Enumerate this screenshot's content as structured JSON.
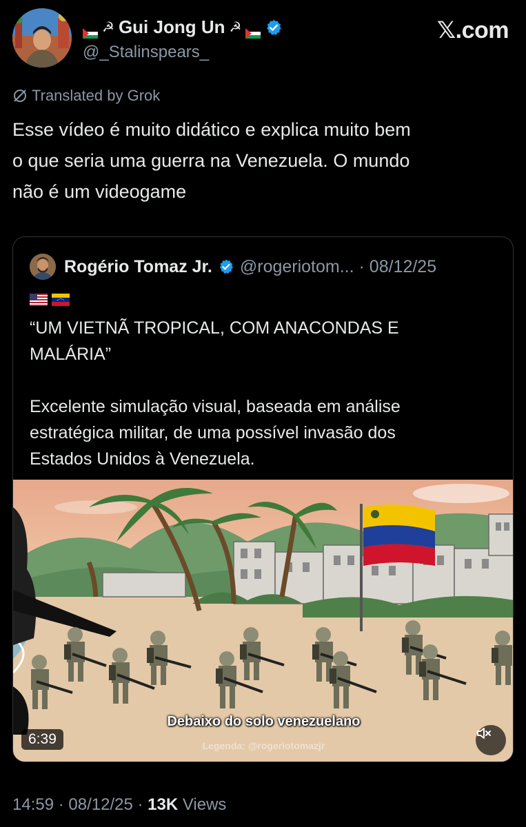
{
  "header": {
    "display_name": "Gui Jong Un",
    "handle": "@_Stalinspears_",
    "site": "𝕏.com"
  },
  "translated_label": "Translated by Grok",
  "tweet": {
    "text_lines": [
      "Esse vídeo é muito didático e explica muito bem",
      "o que seria uma guerra na Venezuela. O mundo",
      "não é um videogame"
    ]
  },
  "quote": {
    "name": "Rogério Tomaz Jr.",
    "handle_date": "@rogeriotom... · 08/12/25",
    "headline_lines": [
      "“UM VIETNÃ TROPICAL, COM ANACONDAS E",
      "MALÁRIA”"
    ],
    "body_lines": [
      "Excelente simulação visual, baseada em análise",
      "estratégica militar, de uma possível invasão dos",
      "Estados Unidos à Venezuela."
    ],
    "video": {
      "caption": "Debaixo do solo venezuelano",
      "watermark": "Legenda: @rogeriotomazjr",
      "duration": "6:39"
    }
  },
  "meta": {
    "time_date": "14:59 · 08/12/25 · ",
    "views_count": "13K",
    "views_label": " Views"
  },
  "colors": {
    "background": "#000000",
    "text": "#e7e9ea",
    "secondary": "#8b98a5",
    "verified": "#1d9bf0"
  }
}
